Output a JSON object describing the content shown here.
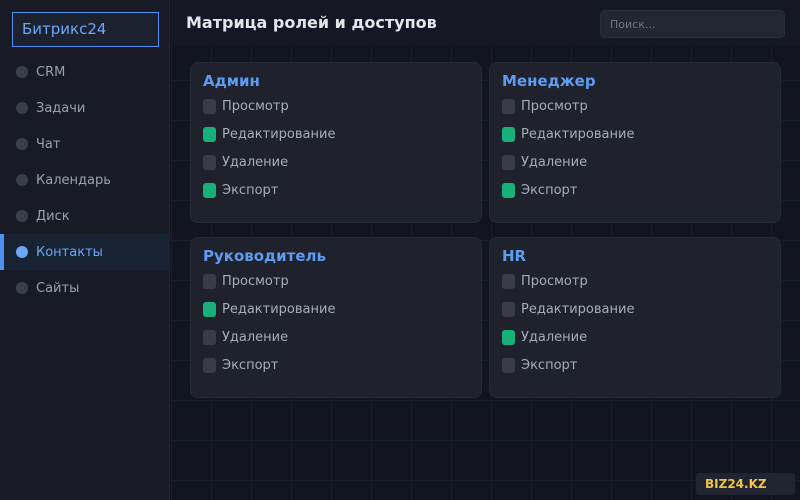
{
  "sidebar": {
    "logo": "Битрикс24",
    "items": [
      {
        "label": "CRM",
        "active": false
      },
      {
        "label": "Задачи",
        "active": false
      },
      {
        "label": "Чат",
        "active": false
      },
      {
        "label": "Календарь",
        "active": false
      },
      {
        "label": "Диск",
        "active": false
      },
      {
        "label": "Контакты",
        "active": true
      },
      {
        "label": "Сайты",
        "active": false
      }
    ]
  },
  "header": {
    "title": "Матрица ролей и доступов",
    "search_placeholder": "Поиск..."
  },
  "roles": [
    {
      "name": "Админ",
      "permissions": [
        {
          "label": "Просмотр",
          "enabled": false
        },
        {
          "label": "Редактирование",
          "enabled": true
        },
        {
          "label": "Удаление",
          "enabled": false
        },
        {
          "label": "Экспорт",
          "enabled": true
        }
      ]
    },
    {
      "name": "Менеджер",
      "permissions": [
        {
          "label": "Просмотр",
          "enabled": false
        },
        {
          "label": "Редактирование",
          "enabled": true
        },
        {
          "label": "Удаление",
          "enabled": false
        },
        {
          "label": "Экспорт",
          "enabled": true
        }
      ]
    },
    {
      "name": "Руководитель",
      "permissions": [
        {
          "label": "Просмотр",
          "enabled": false
        },
        {
          "label": "Редактирование",
          "enabled": true
        },
        {
          "label": "Удаление",
          "enabled": false
        },
        {
          "label": "Экспорт",
          "enabled": false
        }
      ]
    },
    {
      "name": "HR",
      "permissions": [
        {
          "label": "Просмотр",
          "enabled": false
        },
        {
          "label": "Редактирование",
          "enabled": false
        },
        {
          "label": "Удаление",
          "enabled": true
        },
        {
          "label": "Экспорт",
          "enabled": false
        }
      ]
    }
  ],
  "badge": "BIZ24.KZ",
  "colors": {
    "accent": "#4f8ff2",
    "enabled": "#18b07a",
    "disabled": "#3a3d48",
    "badge_text": "#f0c44a"
  }
}
